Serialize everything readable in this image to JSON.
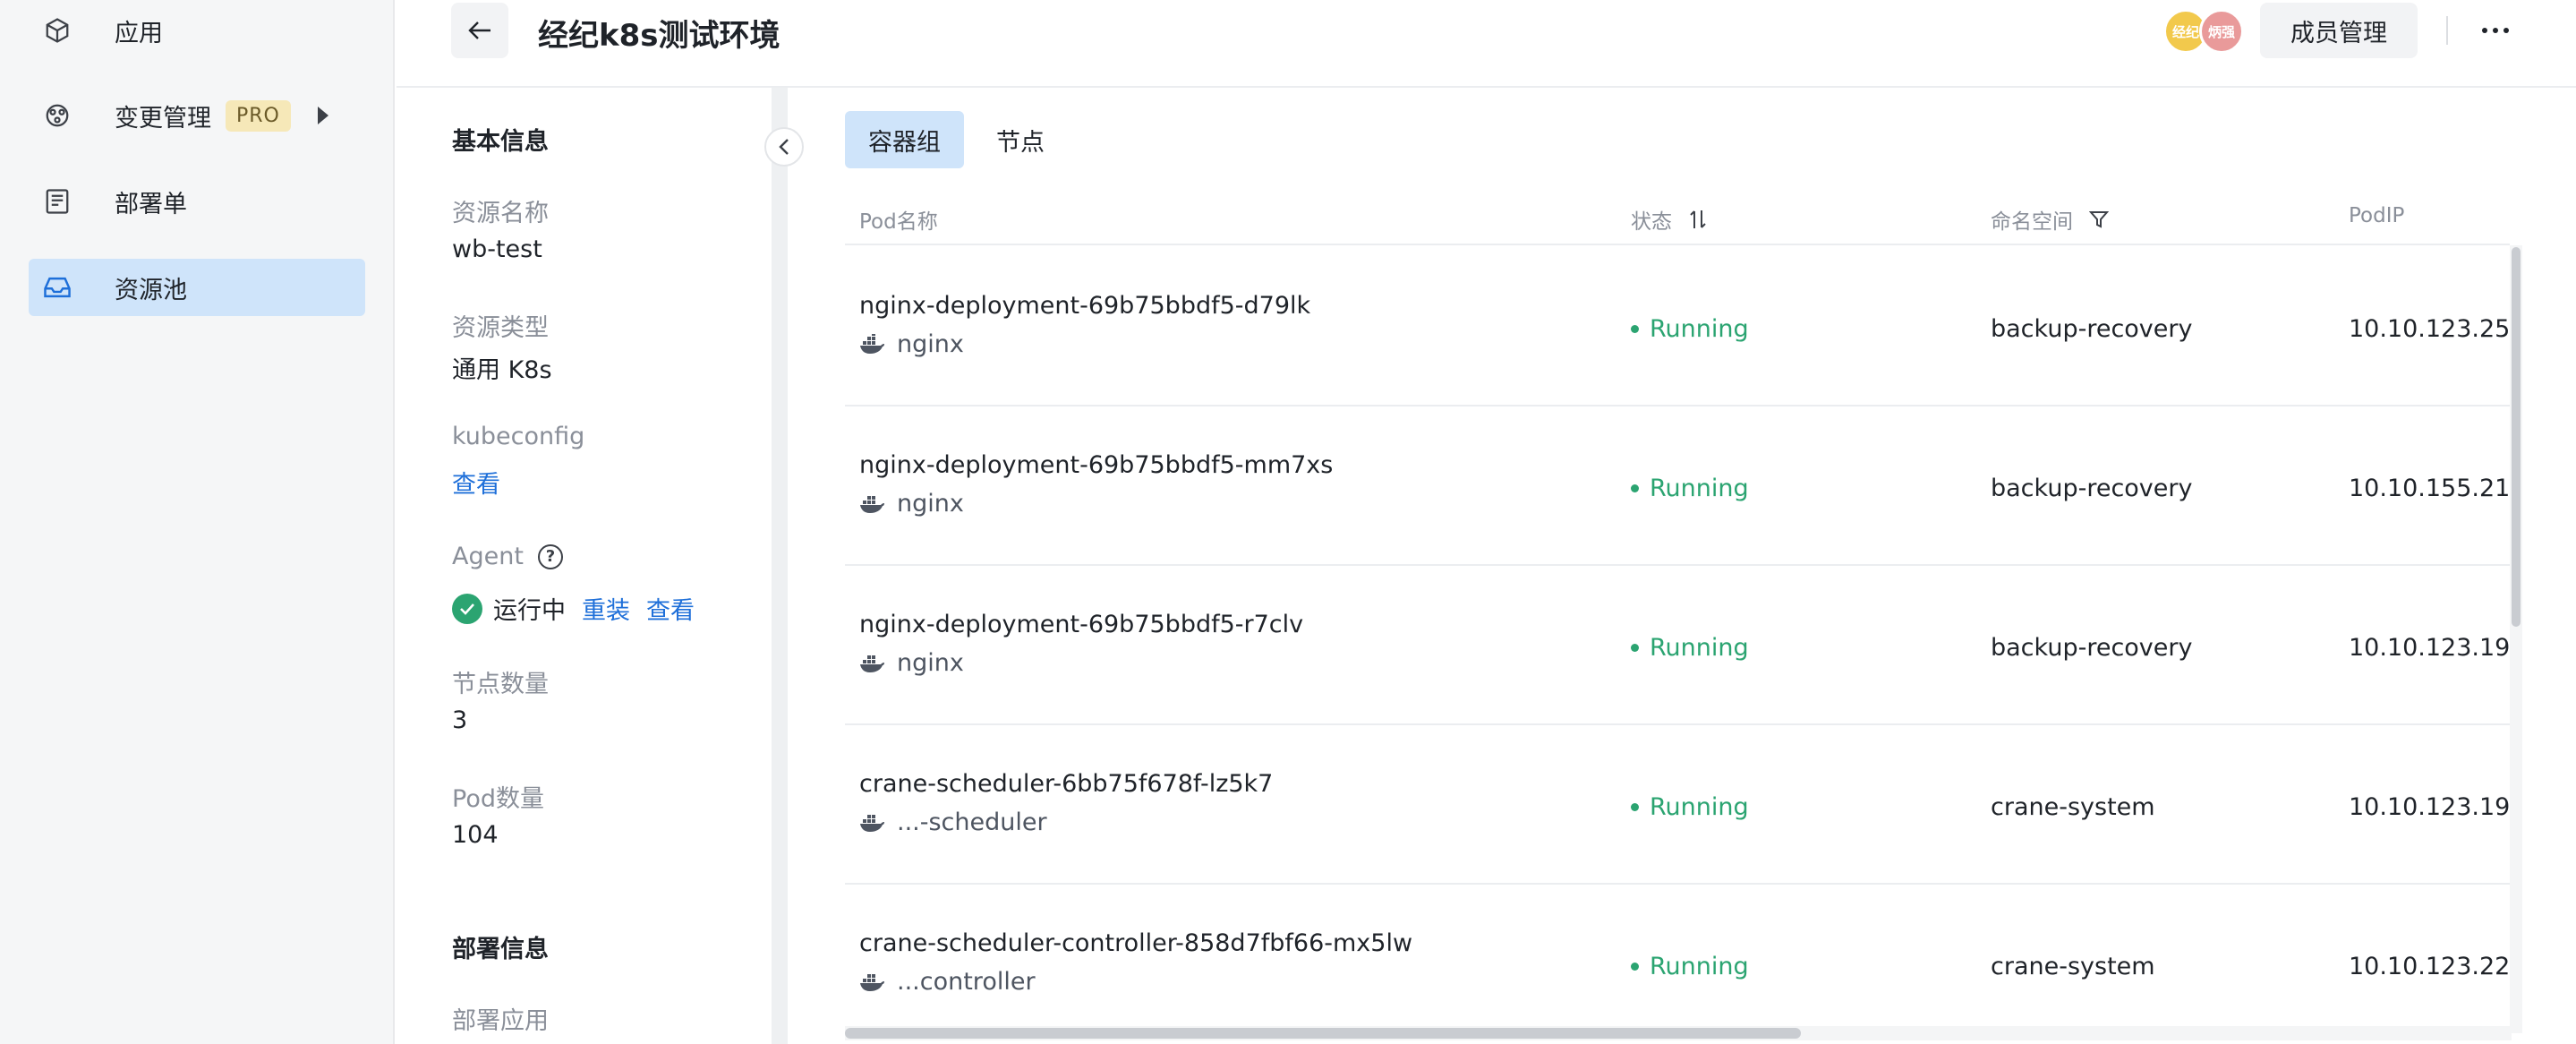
{
  "nav": {
    "items": [
      {
        "label": "应用",
        "icon": "cube-icon"
      },
      {
        "label": "变更管理",
        "icon": "flow-icon",
        "badge": "PRO"
      },
      {
        "label": "部署单",
        "icon": "document-icon"
      },
      {
        "label": "资源池",
        "icon": "inbox-icon",
        "active": true
      }
    ]
  },
  "header": {
    "title": "经纪k8s测试环境",
    "avatars": [
      "经纪",
      "炳强"
    ],
    "member_button": "成员管理"
  },
  "info": {
    "basic_title": "基本信息",
    "resource_name_label": "资源名称",
    "resource_name": "wb-test",
    "resource_type_label": "资源类型",
    "resource_type": "通用 K8s",
    "kubeconfig_label": "kubeconfig",
    "kubeconfig_link": "查看",
    "agent_label": "Agent",
    "agent_status": "运行中",
    "agent_reinstall": "重装",
    "agent_view": "查看",
    "node_count_label": "节点数量",
    "node_count": "3",
    "pod_count_label": "Pod数量",
    "pod_count": "104",
    "deploy_title": "部署信息",
    "deploy_app_label": "部署应用"
  },
  "tabs": [
    {
      "label": "容器组",
      "active": true
    },
    {
      "label": "节点",
      "active": false
    }
  ],
  "table": {
    "columns": {
      "name": "Pod名称",
      "status": "状态",
      "namespace": "命名空间",
      "ip": "PodIP"
    },
    "rows": [
      {
        "name": "nginx-deployment-69b75bbdf5-d79lk",
        "container": "nginx",
        "status": "Running",
        "namespace": "backup-recovery",
        "ip": "10.10.123.25"
      },
      {
        "name": "nginx-deployment-69b75bbdf5-mm7xs",
        "container": "nginx",
        "status": "Running",
        "namespace": "backup-recovery",
        "ip": "10.10.155.21"
      },
      {
        "name": "nginx-deployment-69b75bbdf5-r7clv",
        "container": "nginx",
        "status": "Running",
        "namespace": "backup-recovery",
        "ip": "10.10.123.19"
      },
      {
        "name": "crane-scheduler-6bb75f678f-lz5k7",
        "container": "...-scheduler",
        "status": "Running",
        "namespace": "crane-system",
        "ip": "10.10.123.19"
      },
      {
        "name": "crane-scheduler-controller-858d7fbf66-mx5lw",
        "container": "...controller",
        "status": "Running",
        "namespace": "crane-system",
        "ip": "10.10.123.22"
      }
    ]
  },
  "colors": {
    "accent": "#1e6fd9",
    "active_bg": "#cfe4fa",
    "running": "#2ba471",
    "pro_badge_bg": "#f6e8b8"
  }
}
